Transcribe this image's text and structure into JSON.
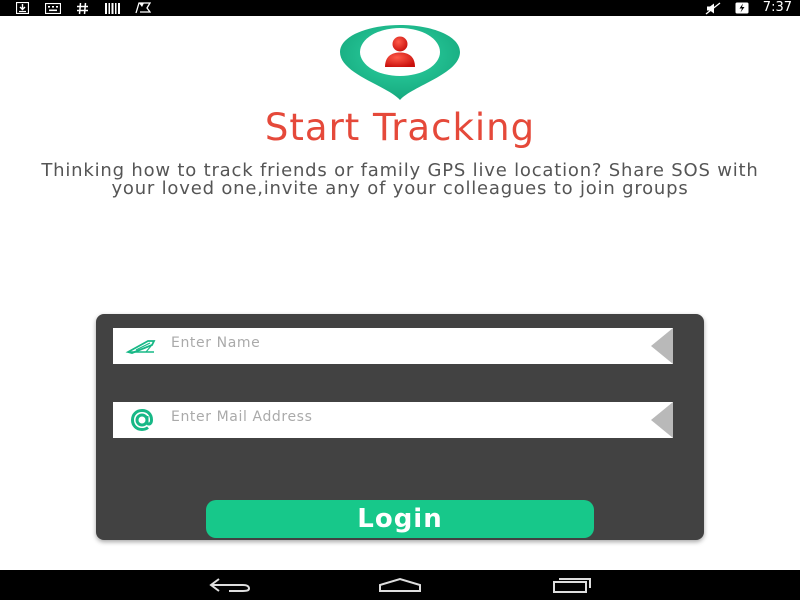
{
  "status_bar": {
    "left_icons": [
      "download-icon",
      "keyboard-icon",
      "hash-icon",
      "barcode-icon",
      "flag-icon"
    ],
    "right_icons": [
      "mute-icon",
      "battery-charging-icon"
    ],
    "time": "7:37"
  },
  "header": {
    "logo": "location-pin-person-icon",
    "title": "Start Tracking",
    "description": "Thinking how to track friends or family GPS live location? Share SOS with your loved one,invite any of your colleagues to join groups"
  },
  "form": {
    "name_field": {
      "placeholder": "Enter Name",
      "value": "",
      "icon": "pen-icon"
    },
    "mail_field": {
      "placeholder": "Enter Mail Address",
      "value": "",
      "icon": "at-icon"
    },
    "login_label": "Login"
  },
  "nav_bar": {
    "buttons": [
      "back-icon",
      "home-icon",
      "recents-icon"
    ]
  },
  "colors": {
    "title": "#e5493a",
    "accent_green": "#17c88a",
    "card_bg": "#424242",
    "pin_teal": "#1fbb8f",
    "person_red": "#e8231d"
  }
}
